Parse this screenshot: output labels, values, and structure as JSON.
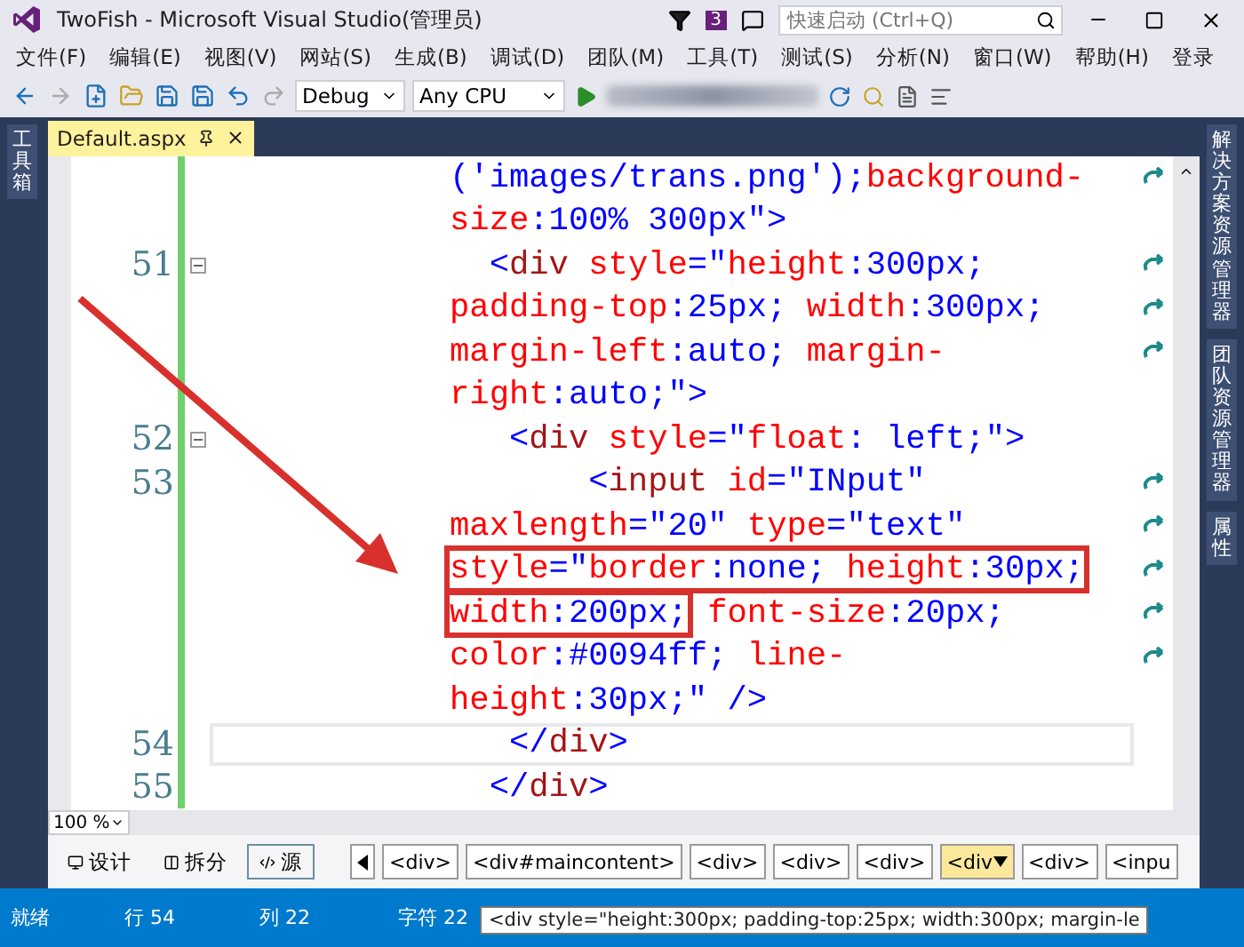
{
  "window": {
    "title": "TwoFish - Microsoft Visual Studio(管理员)",
    "notification_count": "3",
    "quick_launch": {
      "placeholder": "快速启动 (Ctrl+Q)"
    }
  },
  "menu": {
    "items": [
      "文件(F)",
      "编辑(E)",
      "视图(V)",
      "网站(S)",
      "生成(B)",
      "调试(D)",
      "团队(M)",
      "工具(T)",
      "测试(S)",
      "分析(N)",
      "窗口(W)",
      "帮助(H)"
    ],
    "sign_in": "登录"
  },
  "toolbar": {
    "configuration": "Debug",
    "platform": "Any CPU"
  },
  "left_panel": {
    "tabs": [
      "工具箱"
    ]
  },
  "right_panel": {
    "tabs": [
      "解决方案资源管理器",
      "团队资源管理器",
      "属性"
    ]
  },
  "document_tab": {
    "title": "Default.aspx",
    "selected": true
  },
  "editor": {
    "lines": [
      {
        "wrapped": true,
        "changed": true,
        "current": false,
        "tokens": [
          {
            "kind": "value",
            "text": "('images/trans.png');"
          },
          {
            "kind": "attr",
            "text": "background-"
          }
        ]
      },
      {
        "wrapped": false,
        "changed": true,
        "current": false,
        "tokens": [
          {
            "kind": "attr",
            "text": "size"
          },
          {
            "kind": "value",
            "text": ":100% 300px"
          },
          {
            "kind": "bracket",
            "text": "\">"
          }
        ]
      },
      {
        "number": "51",
        "foldable": true,
        "wrapped": true,
        "changed": true,
        "current": false,
        "tokens": [
          {
            "kind": "bracket",
            "text": "  <"
          },
          {
            "kind": "tag",
            "text": "div"
          },
          {
            "kind": "attr",
            "text": " style"
          },
          {
            "kind": "bracket",
            "text": "=\""
          },
          {
            "kind": "attr",
            "text": "height"
          },
          {
            "kind": "value",
            "text": ":300px;"
          }
        ]
      },
      {
        "wrapped": true,
        "changed": true,
        "current": false,
        "tokens": [
          {
            "kind": "attr",
            "text": "padding-top"
          },
          {
            "kind": "value",
            "text": ":25px; "
          },
          {
            "kind": "attr",
            "text": "width"
          },
          {
            "kind": "value",
            "text": ":300px;"
          }
        ]
      },
      {
        "wrapped": true,
        "changed": true,
        "current": false,
        "tokens": [
          {
            "kind": "attr",
            "text": "margin-left"
          },
          {
            "kind": "value",
            "text": ":auto; "
          },
          {
            "kind": "attr",
            "text": "margin-"
          }
        ]
      },
      {
        "wrapped": false,
        "changed": true,
        "current": false,
        "tokens": [
          {
            "kind": "attr",
            "text": "right"
          },
          {
            "kind": "value",
            "text": ":auto;"
          },
          {
            "kind": "bracket",
            "text": "\">"
          }
        ]
      },
      {
        "number": "52",
        "foldable": true,
        "wrapped": false,
        "changed": true,
        "current": false,
        "tokens": [
          {
            "kind": "bracket",
            "text": "   <"
          },
          {
            "kind": "tag",
            "text": "div"
          },
          {
            "kind": "attr",
            "text": " style"
          },
          {
            "kind": "bracket",
            "text": "=\""
          },
          {
            "kind": "attr",
            "text": "float"
          },
          {
            "kind": "value",
            "text": ": left;"
          },
          {
            "kind": "bracket",
            "text": "\">"
          }
        ]
      },
      {
        "number": "53",
        "foldable": false,
        "wrapped": true,
        "changed": true,
        "current": false,
        "tokens": [
          {
            "kind": "bracket",
            "text": "       <"
          },
          {
            "kind": "tag",
            "text": "input"
          },
          {
            "kind": "attr",
            "text": " id"
          },
          {
            "kind": "bracket",
            "text": "="
          },
          {
            "kind": "value",
            "text": "\"INput\""
          }
        ]
      },
      {
        "wrapped": true,
        "changed": true,
        "current": false,
        "tokens": [
          {
            "kind": "attr",
            "text": "maxlength"
          },
          {
            "kind": "bracket",
            "text": "="
          },
          {
            "kind": "value",
            "text": "\"20\""
          },
          {
            "kind": "attr",
            "text": " type"
          },
          {
            "kind": "bracket",
            "text": "="
          },
          {
            "kind": "value",
            "text": "\"text\""
          }
        ]
      },
      {
        "wrapped": true,
        "changed": true,
        "current": false,
        "segments": [
          {
            "boxed": true,
            "tokens": [
              {
                "kind": "attr",
                "text": "style"
              },
              {
                "kind": "bracket",
                "text": "=\""
              },
              {
                "kind": "attr",
                "text": "border"
              },
              {
                "kind": "value",
                "text": ":none; "
              },
              {
                "kind": "attr",
                "text": "height"
              },
              {
                "kind": "value",
                "text": ":30px;"
              }
            ]
          }
        ]
      },
      {
        "wrapped": true,
        "changed": true,
        "current": false,
        "segments": [
          {
            "boxed": true,
            "tokens": [
              {
                "kind": "attr",
                "text": "width"
              },
              {
                "kind": "value",
                "text": ":200px;"
              }
            ]
          },
          {
            "boxed": false,
            "tokens": [
              {
                "kind": "attr",
                "text": " font-size"
              },
              {
                "kind": "value",
                "text": ":20px;"
              }
            ]
          }
        ]
      },
      {
        "wrapped": true,
        "changed": true,
        "current": false,
        "tokens": [
          {
            "kind": "attr",
            "text": "color"
          },
          {
            "kind": "value",
            "text": ":#0094ff; "
          },
          {
            "kind": "attr",
            "text": "line-"
          }
        ]
      },
      {
        "wrapped": false,
        "changed": true,
        "current": false,
        "tokens": [
          {
            "kind": "attr",
            "text": "height"
          },
          {
            "kind": "value",
            "text": ":30px;"
          },
          {
            "kind": "bracket",
            "text": "\" />"
          }
        ]
      },
      {
        "number": "54",
        "foldable": false,
        "wrapped": false,
        "changed": true,
        "current": true,
        "tokens": [
          {
            "kind": "bracket",
            "text": "   </"
          },
          {
            "kind": "tag",
            "text": "div"
          },
          {
            "kind": "bracket",
            "text": ">"
          }
        ]
      },
      {
        "number": "55",
        "foldable": false,
        "wrapped": false,
        "changed": true,
        "current": false,
        "tokens": [
          {
            "kind": "bracket",
            "text": "  </"
          },
          {
            "kind": "tag",
            "text": "div"
          },
          {
            "kind": "bracket",
            "text": ">"
          }
        ]
      }
    ]
  },
  "zoom": {
    "value": "100 %"
  },
  "view_buttons": [
    {
      "label": "设计",
      "selected": false
    },
    {
      "label": "拆分",
      "selected": false
    },
    {
      "label": "源",
      "selected": true
    }
  ],
  "breadcrumb": [
    {
      "label": "<div>",
      "selected": false
    },
    {
      "label": "<div#maincontent>",
      "selected": false
    },
    {
      "label": "<div>",
      "selected": false
    },
    {
      "label": "<div>",
      "selected": false
    },
    {
      "label": "<div>",
      "selected": false
    },
    {
      "label": "<div",
      "selected": true
    },
    {
      "label": "<div>",
      "selected": false
    },
    {
      "label": "<inpu",
      "selected": false
    }
  ],
  "status_bar": {
    "items": [
      "就绪",
      "行 54",
      "列 22",
      "字符 22"
    ]
  },
  "tooltip": {
    "text": "<div style=\"height:300px; padding-top:25px; width:300px; margin-le"
  }
}
